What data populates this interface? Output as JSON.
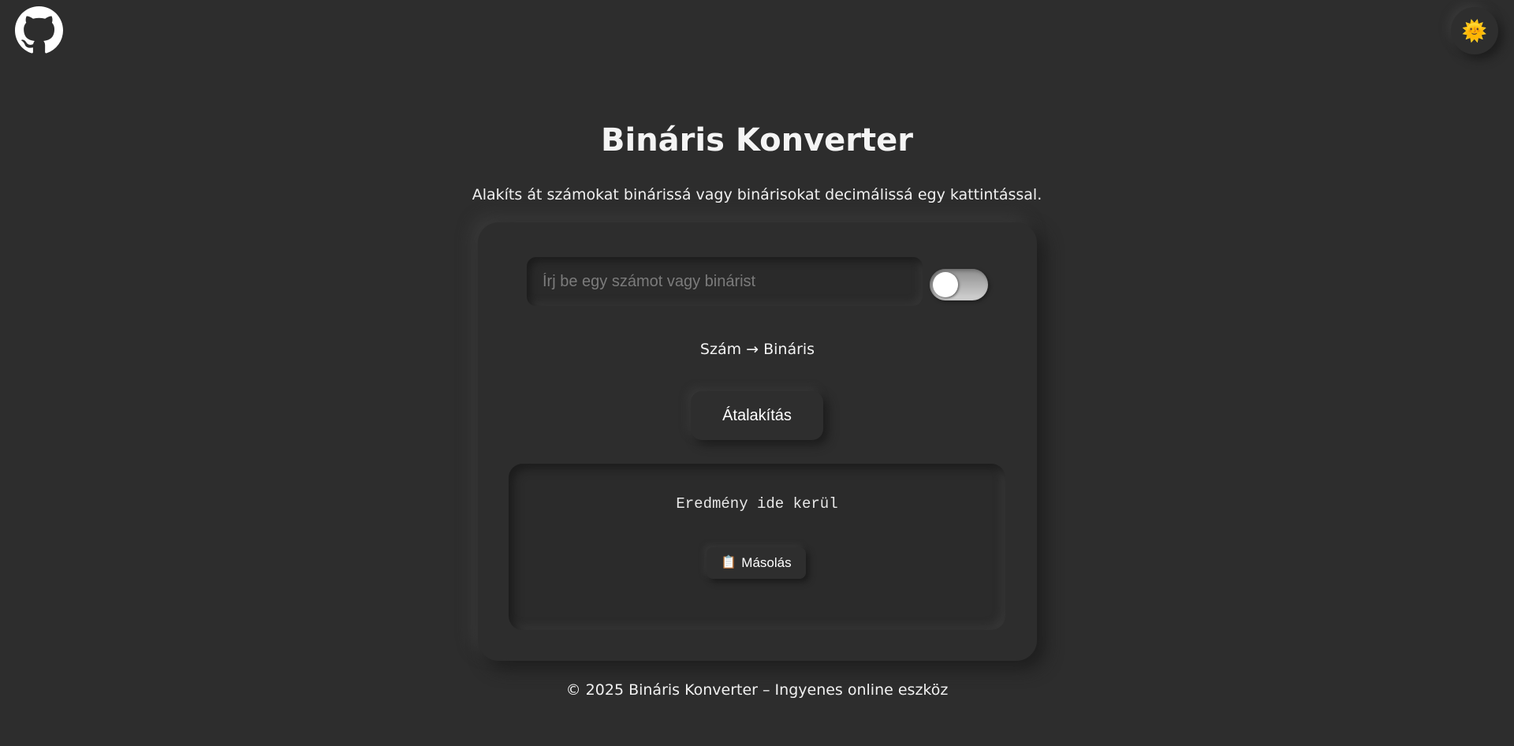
{
  "header": {
    "github_icon": "github-icon",
    "theme_icon": "sun-icon",
    "theme_glyph": "🌞"
  },
  "main": {
    "title": "Bináris Konverter",
    "subtitle": "Alakíts át számokat binárissá vagy binárisokat decimálissá egy kattintással."
  },
  "converter": {
    "input_value": "",
    "input_placeholder": "Írj be egy számot vagy binárist",
    "mode_toggle_on": false,
    "mode_label": "Szám → Bináris",
    "convert_label": "Átalakítás",
    "result_text": "Eredmény ide kerül",
    "copy_glyph": "📋",
    "copy_label": "Másolás"
  },
  "footer": {
    "text": "© 2025 Bináris Konverter – Ingyenes online eszköz"
  },
  "colors": {
    "background": "#2d2d2d",
    "text": "#f2f2f2",
    "sun": "#f5c518"
  }
}
